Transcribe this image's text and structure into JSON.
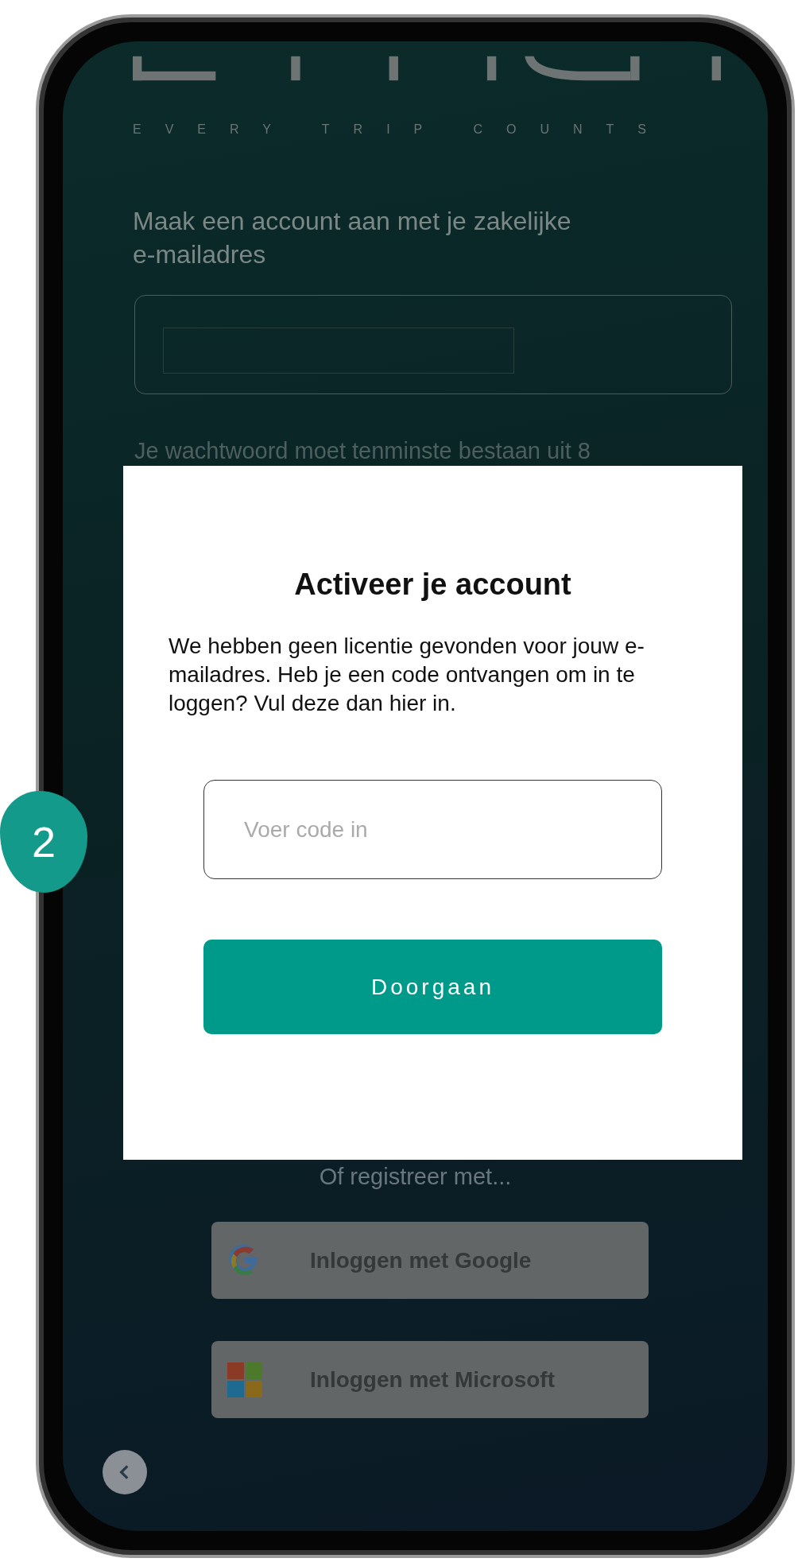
{
  "logo_tagline": "EVERY TRIP COUNTS",
  "heading": "Maak een account aan met je zakelijke e-mailadres",
  "password_hint": "Je wachtwoord moet tenminste bestaan uit 8",
  "dialog": {
    "title": "Activeer je account",
    "message": "We hebben geen licentie gevonden voor jouw e-mailadres. Heb je een code ontvangen om in te loggen? Vul deze dan hier in.",
    "code_field": {
      "placeholder": "Voer code in"
    },
    "button": "Doorgaan"
  },
  "divider_text": "Of registreer met...",
  "social_buttons": [
    {
      "kind": "google",
      "label": "Inloggen met Google"
    },
    {
      "kind": "microsoft",
      "label": "Inloggen met Microsoft"
    }
  ],
  "step_badge": "2"
}
